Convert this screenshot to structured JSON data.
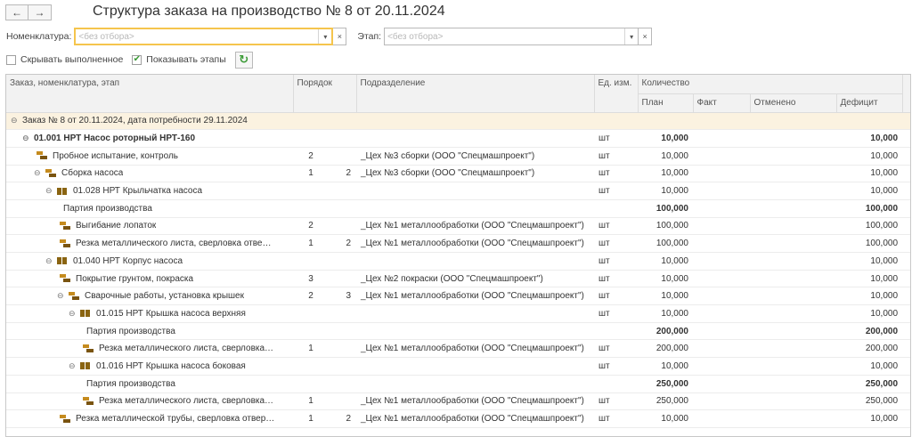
{
  "nav": {
    "back": "←",
    "forward": "→"
  },
  "title": "Структура заказа на производство № 8 от 20.11.2024",
  "filters": {
    "nomenclature_label": "Номенклатура:",
    "nomenclature_placeholder": "<без отбора>",
    "stage_label": "Этап:",
    "stage_placeholder": "<без отбора>",
    "dropdown_glyph": "▾",
    "clear_glyph": "×"
  },
  "options": {
    "hide_done_label": "Скрывать выполненное",
    "hide_done_checked": false,
    "show_stages_label": "Показывать этапы",
    "show_stages_checked": true,
    "check_glyph": "✔",
    "refresh_glyph": "↻"
  },
  "columns": {
    "name": "Заказ, номенклатура, этап",
    "order": "Порядок",
    "division": "Подразделение",
    "unit": "Ед. изм.",
    "quantity": "Количество",
    "plan": "План",
    "fact": "Факт",
    "cancelled": "Отменено",
    "deficit": "Дефицит"
  },
  "rows": [
    {
      "type": "group",
      "level": 0,
      "toggle": "⊖",
      "icon": "",
      "name": "Заказ № 8 от 20.11.2024, дата потребности 29.11.2024",
      "order1": "",
      "order2": "",
      "division": "",
      "unit": "",
      "plan": "",
      "deficit": ""
    },
    {
      "type": "bold",
      "level": 1,
      "toggle": "⊖",
      "icon": "",
      "name": "01.001 НРТ Насос роторный НРТ-160",
      "order1": "",
      "order2": "",
      "division": "",
      "unit": "шт",
      "plan": "10,000",
      "deficit": "10,000"
    },
    {
      "type": "normal",
      "level": 2,
      "toggle": "",
      "icon": "op",
      "name": "Пробное испытание, контроль",
      "order1": "2",
      "order2": "",
      "division": "_Цех №3 сборки (ООО \"Спецмашпроект\")",
      "unit": "шт",
      "plan": "10,000",
      "deficit": "10,000"
    },
    {
      "type": "normal",
      "level": 2,
      "toggle": "⊖",
      "icon": "op",
      "name": "Сборка насоса",
      "order1": "1",
      "order2": "2",
      "division": "_Цех №3 сборки (ООО \"Спецмашпроект\")",
      "unit": "шт",
      "plan": "10,000",
      "deficit": "10,000"
    },
    {
      "type": "normal",
      "level": 3,
      "toggle": "⊖",
      "icon": "item",
      "name": "01.028 НРТ Крыльчатка насоса",
      "order1": "",
      "order2": "",
      "division": "",
      "unit": "шт",
      "plan": "10,000",
      "deficit": "10,000"
    },
    {
      "type": "bold",
      "level": 4,
      "toggle": "",
      "icon": "",
      "name": "Партия производства",
      "order1": "",
      "order2": "",
      "division": "",
      "unit": "",
      "plan": "100,000",
      "deficit": "100,000",
      "namebold": false
    },
    {
      "type": "normal",
      "level": 4,
      "toggle": "",
      "icon": "op",
      "name": "Выгибание лопаток",
      "order1": "2",
      "order2": "",
      "division": "_Цех №1 металлообработки (ООО \"Спецмашпроект\")",
      "unit": "шт",
      "plan": "100,000",
      "deficit": "100,000"
    },
    {
      "type": "normal",
      "level": 4,
      "toggle": "",
      "icon": "op",
      "name": "Резка металлического листа, сверловка отве…",
      "order1": "1",
      "order2": "2",
      "division": "_Цех №1 металлообработки (ООО \"Спецмашпроект\")",
      "unit": "шт",
      "plan": "100,000",
      "deficit": "100,000"
    },
    {
      "type": "normal",
      "level": 3,
      "toggle": "⊖",
      "icon": "item",
      "name": "01.040 НРТ Корпус насоса",
      "order1": "",
      "order2": "",
      "division": "",
      "unit": "шт",
      "plan": "10,000",
      "deficit": "10,000"
    },
    {
      "type": "normal",
      "level": 4,
      "toggle": "",
      "icon": "op",
      "name": "Покрытие грунтом, покраска",
      "order1": "3",
      "order2": "",
      "division": "_Цех №2 покраски (ООО \"Спецмашпроект\")",
      "unit": "шт",
      "plan": "10,000",
      "deficit": "10,000"
    },
    {
      "type": "normal",
      "level": 4,
      "toggle": "⊖",
      "icon": "op",
      "name": "Сварочные работы, установка крышек",
      "order1": "2",
      "order2": "3",
      "division": "_Цех №1 металлообработки (ООО \"Спецмашпроект\")",
      "unit": "шт",
      "plan": "10,000",
      "deficit": "10,000"
    },
    {
      "type": "normal",
      "level": 5,
      "toggle": "⊖",
      "icon": "item",
      "name": "01.015 НРТ Крышка насоса верхняя",
      "order1": "",
      "order2": "",
      "division": "",
      "unit": "шт",
      "plan": "10,000",
      "deficit": "10,000"
    },
    {
      "type": "bold",
      "level": 6,
      "toggle": "",
      "icon": "",
      "name": "Партия производства",
      "order1": "",
      "order2": "",
      "division": "",
      "unit": "",
      "plan": "200,000",
      "deficit": "200,000",
      "namebold": false
    },
    {
      "type": "normal",
      "level": 6,
      "toggle": "",
      "icon": "op",
      "name": "Резка металлического листа, сверловка…",
      "order1": "1",
      "order2": "",
      "division": "_Цех №1 металлообработки (ООО \"Спецмашпроект\")",
      "unit": "шт",
      "plan": "200,000",
      "deficit": "200,000"
    },
    {
      "type": "normal",
      "level": 5,
      "toggle": "⊖",
      "icon": "item",
      "name": "01.016 НРТ Крышка насоса боковая",
      "order1": "",
      "order2": "",
      "division": "",
      "unit": "шт",
      "plan": "10,000",
      "deficit": "10,000"
    },
    {
      "type": "bold",
      "level": 6,
      "toggle": "",
      "icon": "",
      "name": "Партия производства",
      "order1": "",
      "order2": "",
      "division": "",
      "unit": "",
      "plan": "250,000",
      "deficit": "250,000",
      "namebold": false
    },
    {
      "type": "normal",
      "level": 6,
      "toggle": "",
      "icon": "op",
      "name": "Резка металлического листа, сверловка…",
      "order1": "1",
      "order2": "",
      "division": "_Цех №1 металлообработки (ООО \"Спецмашпроект\")",
      "unit": "шт",
      "plan": "250,000",
      "deficit": "250,000"
    },
    {
      "type": "normal",
      "level": 4,
      "toggle": "",
      "icon": "op",
      "name": "Резка металлической трубы, сверловка отвер…",
      "order1": "1",
      "order2": "2",
      "division": "_Цех №1 металлообработки (ООО \"Спецмашпроект\")",
      "unit": "шт",
      "plan": "10,000",
      "deficit": "10,000"
    }
  ],
  "colors": {
    "group_bg": "#fbf2e0",
    "active_border": "#f5c54d",
    "accent_green": "#3a9a35"
  }
}
